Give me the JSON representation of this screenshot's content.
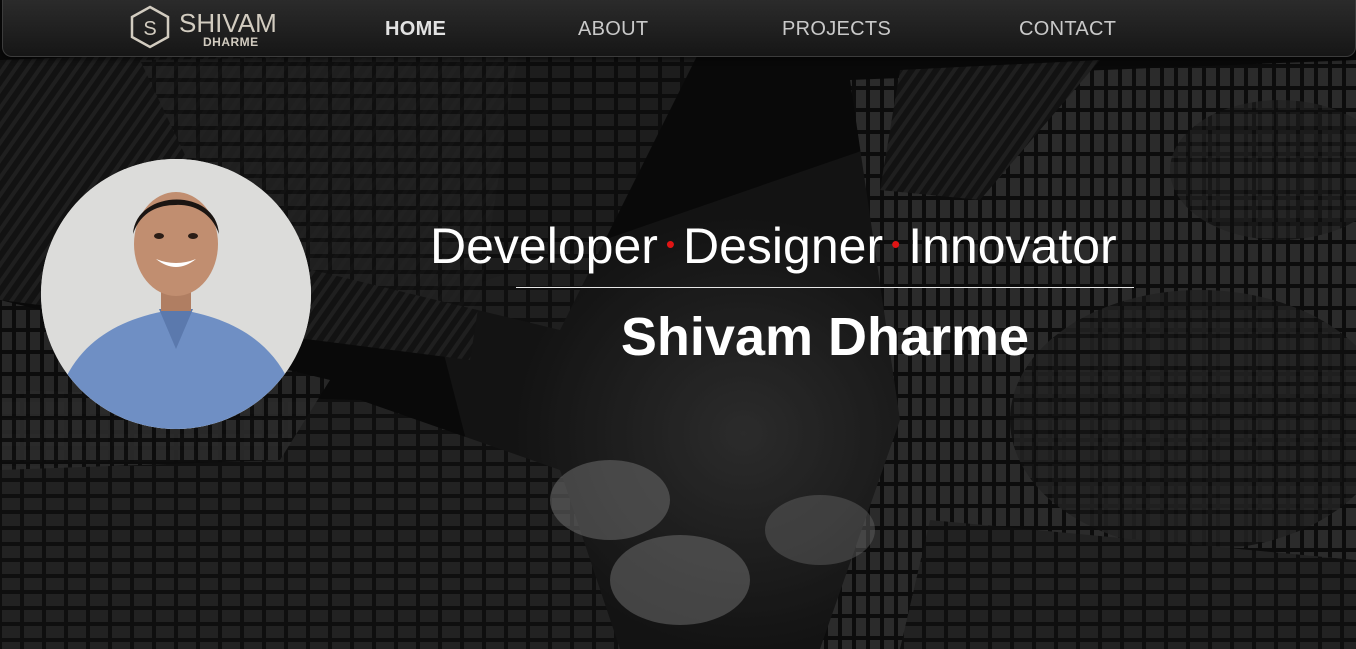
{
  "logo": {
    "name": "SHIVAM",
    "subname": "DHARME",
    "monogram": "S"
  },
  "nav": {
    "items": [
      {
        "label": "HOME",
        "active": true
      },
      {
        "label": "ABOUT",
        "active": false
      },
      {
        "label": "PROJECTS",
        "active": false
      },
      {
        "label": "CONTACT",
        "active": false
      }
    ]
  },
  "hero": {
    "roles": [
      "Developer",
      "Designer",
      "Innovator"
    ],
    "separator": "•",
    "name": "Shivam Dharme",
    "background": "black-and-white skyscrapers looking up"
  },
  "colors": {
    "accent": "#e01414",
    "text": "#ffffff",
    "nav_text": "#c9c9c9",
    "logo": "#d2ccc0"
  }
}
